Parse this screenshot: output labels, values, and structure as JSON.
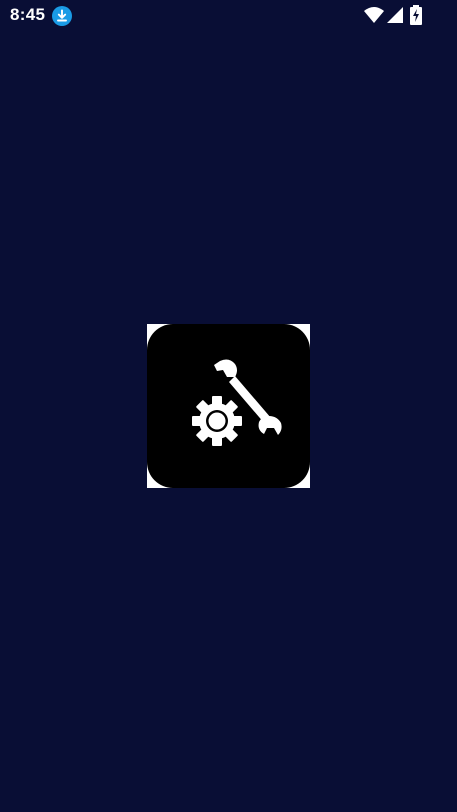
{
  "status_bar": {
    "time": "8:45",
    "icons": [
      "download-icon",
      "wifi-icon",
      "cellular-signal-icon",
      "battery-charging-icon"
    ],
    "download_badge_color": "#1a9be6"
  },
  "splash": {
    "logo_icon": "gear-wrench-icon",
    "logo_background": "#000000",
    "logo_glyph_color": "#ffffff"
  },
  "colors": {
    "background": "#090e35",
    "status_text": "#ffffff"
  }
}
